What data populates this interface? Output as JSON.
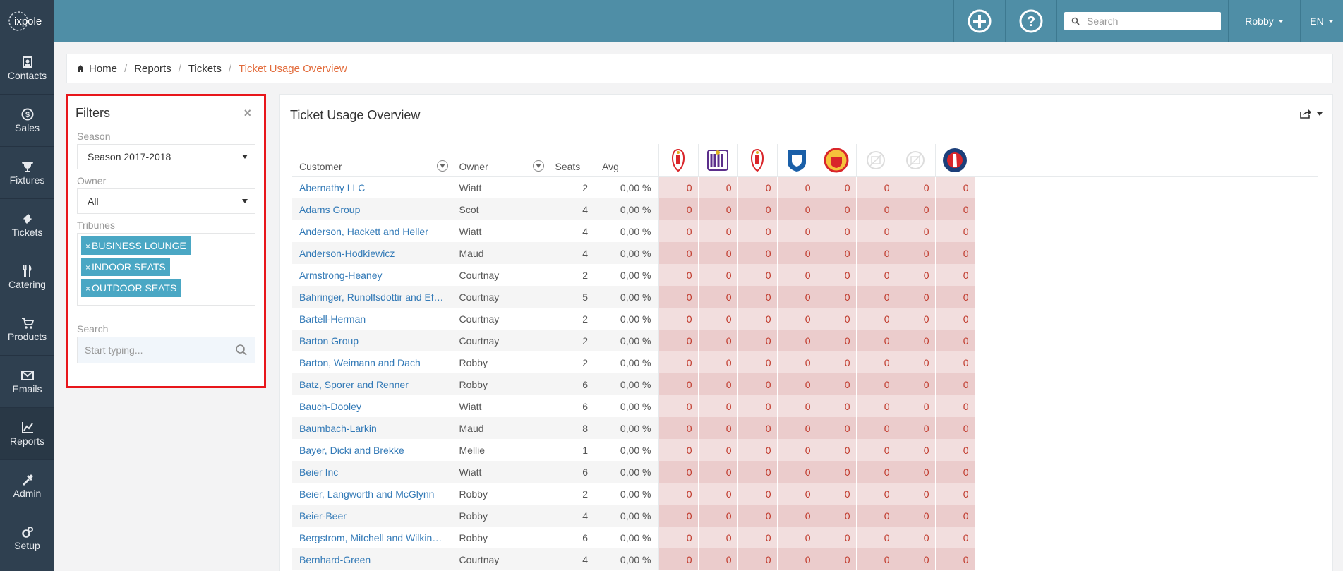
{
  "sidebar": {
    "logo_text": "ixpole",
    "items": [
      {
        "label": "Contacts",
        "icon": "contacts-icon"
      },
      {
        "label": "Sales",
        "icon": "dollar-icon"
      },
      {
        "label": "Fixtures",
        "icon": "trophy-icon"
      },
      {
        "label": "Tickets",
        "icon": "ticket-icon"
      },
      {
        "label": "Catering",
        "icon": "cutlery-icon"
      },
      {
        "label": "Products",
        "icon": "cart-icon"
      },
      {
        "label": "Emails",
        "icon": "envelope-icon"
      },
      {
        "label": "Reports",
        "icon": "chart-icon"
      },
      {
        "label": "Admin",
        "icon": "tools-icon"
      },
      {
        "label": "Setup",
        "icon": "cogs-icon"
      }
    ],
    "active": "Reports"
  },
  "topbar": {
    "search_placeholder": "Search",
    "user": "Robby",
    "lang": "EN"
  },
  "breadcrumb": {
    "home": "Home",
    "reports": "Reports",
    "tickets": "Tickets",
    "current": "Ticket Usage Overview"
  },
  "filters": {
    "title": "Filters",
    "close": "×",
    "season_label": "Season",
    "season_value": "Season 2017-2018",
    "owner_label": "Owner",
    "owner_value": "All",
    "tribunes_label": "Tribunes",
    "tribunes": [
      "BUSINESS LOUNGE",
      "INDOOR SEATS",
      "OUTDOOR SEATS"
    ],
    "tag_remove": "×",
    "search_label": "Search",
    "search_placeholder": "Start typing..."
  },
  "main": {
    "title": "Ticket Usage Overview",
    "columns": {
      "customer": "Customer",
      "owner": "Owner",
      "seats": "Seats",
      "avg": "Avg"
    },
    "rows": [
      {
        "customer": "Abernathy LLC",
        "owner": "Wiatt",
        "seats": "2",
        "avg": "0,00 %"
      },
      {
        "customer": "Adams Group",
        "owner": "Scot",
        "seats": "4",
        "avg": "0,00 %"
      },
      {
        "customer": "Anderson, Hackett and Heller",
        "owner": "Wiatt",
        "seats": "4",
        "avg": "0,00 %"
      },
      {
        "customer": "Anderson-Hodkiewicz",
        "owner": "Maud",
        "seats": "4",
        "avg": "0,00 %"
      },
      {
        "customer": "Armstrong-Heaney",
        "owner": "Courtnay",
        "seats": "2",
        "avg": "0,00 %"
      },
      {
        "customer": "Bahringer, Runolfsdottir and Eff...",
        "owner": "Courtnay",
        "seats": "5",
        "avg": "0,00 %"
      },
      {
        "customer": "Bartell-Herman",
        "owner": "Courtnay",
        "seats": "2",
        "avg": "0,00 %"
      },
      {
        "customer": "Barton Group",
        "owner": "Courtnay",
        "seats": "2",
        "avg": "0,00 %"
      },
      {
        "customer": "Barton, Weimann and Dach",
        "owner": "Robby",
        "seats": "2",
        "avg": "0,00 %"
      },
      {
        "customer": "Batz, Sporer and Renner",
        "owner": "Robby",
        "seats": "6",
        "avg": "0,00 %"
      },
      {
        "customer": "Bauch-Dooley",
        "owner": "Wiatt",
        "seats": "6",
        "avg": "0,00 %"
      },
      {
        "customer": "Baumbach-Larkin",
        "owner": "Maud",
        "seats": "8",
        "avg": "0,00 %"
      },
      {
        "customer": "Bayer, Dicki and Brekke",
        "owner": "Mellie",
        "seats": "1",
        "avg": "0,00 %"
      },
      {
        "customer": "Beier Inc",
        "owner": "Wiatt",
        "seats": "6",
        "avg": "0,00 %"
      },
      {
        "customer": "Beier, Langworth and McGlynn",
        "owner": "Robby",
        "seats": "2",
        "avg": "0,00 %"
      },
      {
        "customer": "Beier-Beer",
        "owner": "Robby",
        "seats": "4",
        "avg": "0,00 %"
      },
      {
        "customer": "Bergstrom, Mitchell and Wilkins...",
        "owner": "Robby",
        "seats": "6",
        "avg": "0,00 %"
      },
      {
        "customer": "Bernhard-Green",
        "owner": "Courtnay",
        "seats": "4",
        "avg": "0,00 %"
      }
    ],
    "match_value": "0",
    "teams": [
      {
        "icon": "standard-liege-logo-icon",
        "color": "#d9252a"
      },
      {
        "icon": "anderlecht-logo-icon",
        "color": "#5b2e8b"
      },
      {
        "icon": "standard-liege-logo-icon",
        "color": "#d9252a"
      },
      {
        "icon": "genk-logo-icon",
        "color": "#1a5fa8"
      },
      {
        "icon": "manchester-united-logo-icon",
        "color": "#d9252a"
      },
      {
        "icon": "placeholder-logo-icon",
        "color": "#dddddd"
      },
      {
        "icon": "placeholder-logo-icon",
        "color": "#dddddd"
      },
      {
        "icon": "psg-logo-icon",
        "color": "#1c3f7a"
      }
    ]
  }
}
